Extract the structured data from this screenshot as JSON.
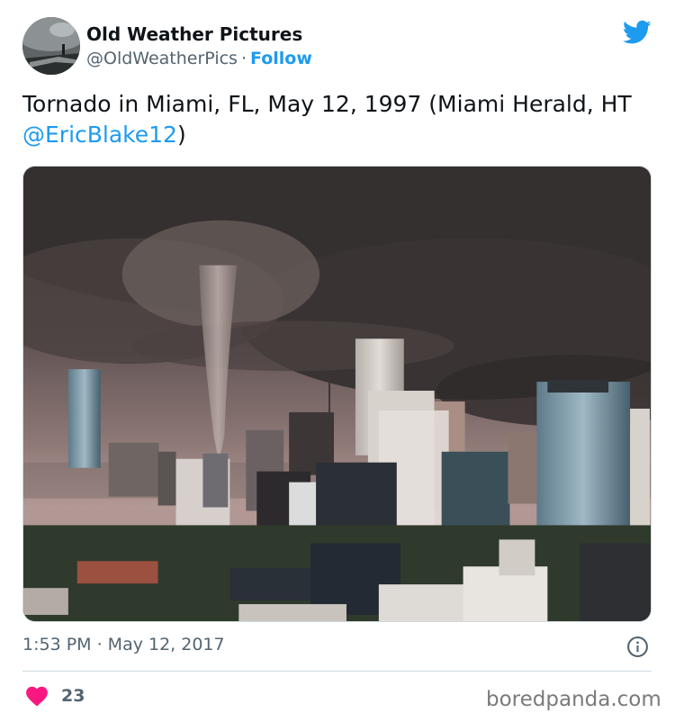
{
  "author": {
    "display_name": "Old Weather Pictures",
    "handle": "@OldWeatherPics",
    "separator": "·",
    "follow_label": "Follow"
  },
  "icons": {
    "brand": "twitter-bird-icon",
    "info": "info-icon",
    "like": "heart-icon"
  },
  "tweet": {
    "text_before_mention": "Tornado in Miami, FL, May 12, 1997 (Miami Herald, HT ",
    "mention": "@EricBlake12",
    "text_after_mention": ")",
    "timestamp": "1:53 PM · May 12, 2017",
    "like_count": "23"
  },
  "watermark": "boredpanda.com",
  "colors": {
    "accent": "#1d9bf0",
    "heart": "#f91880",
    "secondary_text": "#536471"
  }
}
